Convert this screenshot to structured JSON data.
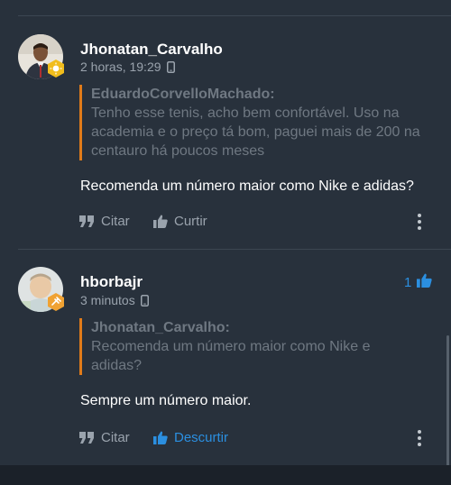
{
  "posts": [
    {
      "author": "Jhonatan_Carvalho",
      "time": "2 horas, 19:29",
      "quote": {
        "author": "EduardoCorvelloMachado:",
        "text": "Tenho esse tenis, acho bem confortável. Uso na academia e o preço tá bom, paguei mais de 200 na centauro há poucos meses"
      },
      "body": "Recomenda um número maior como Nike e adidas?",
      "actions": {
        "quote": "Citar",
        "like": "Curtir"
      }
    },
    {
      "author": "hborbajr",
      "time": "3 minutos",
      "like_count": "1",
      "quote": {
        "author": "Jhonatan_Carvalho:",
        "text": "Recomenda um número maior como Nike e adidas?"
      },
      "body": "Sempre um número maior.",
      "actions": {
        "quote": "Citar",
        "like": "Descurtir"
      }
    }
  ],
  "colors": {
    "background": "#28313c",
    "accent_blue": "#2b8fe0",
    "quote_bar": "#e07b1a",
    "muted_text": "#9aa3ad"
  },
  "icons": [
    "mobile-device-icon",
    "quote-icon",
    "thumbs-up-icon",
    "more-vertical-icon",
    "rank-badge-icon"
  ]
}
